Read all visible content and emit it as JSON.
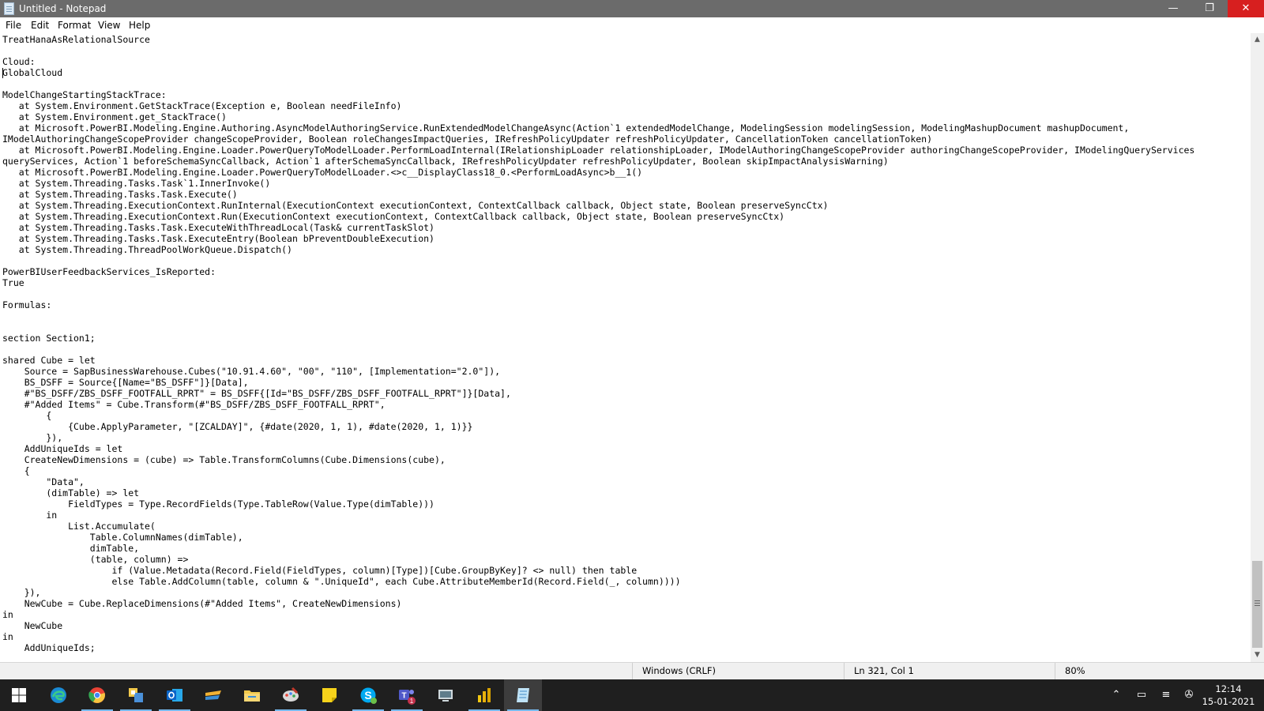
{
  "window": {
    "title": "Untitled - Notepad",
    "controls": {
      "minimize": "—",
      "maximize": "❐",
      "close": "✕"
    }
  },
  "menu": [
    "File",
    "Edit",
    "Format",
    "View",
    "Help"
  ],
  "editor": {
    "text": "TreatHanaAsRelationalSource\n\nCloud:\nGlobalCloud\n\nModelChangeStartingStackTrace:\n   at System.Environment.GetStackTrace(Exception e, Boolean needFileInfo)\n   at System.Environment.get_StackTrace()\n   at Microsoft.PowerBI.Modeling.Engine.Authoring.AsyncModelAuthoringService.RunExtendedModelChangeAsync(Action`1 extendedModelChange, ModelingSession modelingSession, ModelingMashupDocument mashupDocument,\nIModelAuthoringChangeScopeProvider changeScopeProvider, Boolean roleChangesImpactQueries, IRefreshPolicyUpdater refreshPolicyUpdater, CancellationToken cancellationToken)\n   at Microsoft.PowerBI.Modeling.Engine.Loader.PowerQueryToModelLoader.PerformLoadInternal(IRelationshipLoader relationshipLoader, IModelAuthoringChangeScopeProvider authoringChangeScopeProvider, IModelingQueryServices\nqueryServices, Action`1 beforeSchemaSyncCallback, Action`1 afterSchemaSyncCallback, IRefreshPolicyUpdater refreshPolicyUpdater, Boolean skipImpactAnalysisWarning)\n   at Microsoft.PowerBI.Modeling.Engine.Loader.PowerQueryToModelLoader.<>c__DisplayClass18_0.<PerformLoadAsync>b__1()\n   at System.Threading.Tasks.Task`1.InnerInvoke()\n   at System.Threading.Tasks.Task.Execute()\n   at System.Threading.ExecutionContext.RunInternal(ExecutionContext executionContext, ContextCallback callback, Object state, Boolean preserveSyncCtx)\n   at System.Threading.ExecutionContext.Run(ExecutionContext executionContext, ContextCallback callback, Object state, Boolean preserveSyncCtx)\n   at System.Threading.Tasks.Task.ExecuteWithThreadLocal(Task& currentTaskSlot)\n   at System.Threading.Tasks.Task.ExecuteEntry(Boolean bPreventDoubleExecution)\n   at System.Threading.ThreadPoolWorkQueue.Dispatch()\n\nPowerBIUserFeedbackServices_IsReported:\nTrue\n\nFormulas:\n\n\nsection Section1;\n\nshared Cube = let\n    Source = SapBusinessWarehouse.Cubes(\"10.91.4.60\", \"00\", \"110\", [Implementation=\"2.0\"]),\n    BS_DSFF = Source{[Name=\"BS_DSFF\"]}[Data],\n    #\"BS_DSFF/ZBS_DSFF_FOOTFALL_RPRT\" = BS_DSFF{[Id=\"BS_DSFF/ZBS_DSFF_FOOTFALL_RPRT\"]}[Data],\n    #\"Added Items\" = Cube.Transform(#\"BS_DSFF/ZBS_DSFF_FOOTFALL_RPRT\",\n        {\n            {Cube.ApplyParameter, \"[ZCALDAY]\", {#date(2020, 1, 1), #date(2020, 1, 1)}}\n        }),\n    AddUniqueIds = let\n    CreateNewDimensions = (cube) => Table.TransformColumns(Cube.Dimensions(cube),\n    {\n        \"Data\",\n        (dimTable) => let\n            FieldTypes = Type.RecordFields(Type.TableRow(Value.Type(dimTable)))\n        in\n            List.Accumulate(\n                Table.ColumnNames(dimTable),\n                dimTable,\n                (table, column) =>\n                    if (Value.Metadata(Record.Field(FieldTypes, column)[Type])[Cube.GroupByKey]? <> null) then table\n                    else Table.AddColumn(table, column & \".UniqueId\", each Cube.AttributeMemberId(Record.Field(_, column))))\n    }),\n    NewCube = Cube.ReplaceDimensions(#\"Added Items\", CreateNewDimensions)\nin\n    NewCube\nin\n    AddUniqueIds;"
  },
  "scrollbar": {
    "up_arrow": "▲",
    "down_arrow": "▼",
    "position_fraction": 0.87
  },
  "status": {
    "line_endings": "Windows (CRLF)",
    "cursor": "Ln 321, Col 1",
    "zoom": "80%"
  },
  "taskbar": {
    "apps": [
      {
        "name": "windows-start-icon"
      },
      {
        "name": "edge-icon"
      },
      {
        "name": "chrome-icon"
      },
      {
        "name": "app-icon"
      },
      {
        "name": "outlook-icon"
      },
      {
        "name": "sap-icon"
      },
      {
        "name": "file-explorer-icon"
      },
      {
        "name": "paint-icon"
      },
      {
        "name": "sticky-notes-icon"
      },
      {
        "name": "skype-icon"
      },
      {
        "name": "teams-icon",
        "badge": "1"
      },
      {
        "name": "network-app-icon"
      },
      {
        "name": "power-bi-icon"
      },
      {
        "name": "notepad-icon"
      }
    ],
    "tray": {
      "chevron": "⌃",
      "battery": "▭",
      "wifi": "≡",
      "volume": "✇"
    },
    "time": "12:14",
    "date": "15-01-2021"
  },
  "colors": {
    "titlebar": "#6b6b6b",
    "close": "#d71f1f",
    "taskbar": "#1f1f1f",
    "edge": "#1a8ad4",
    "chrome": "#e94235",
    "outlook": "#0a64c8",
    "explorer": "#f2c94c",
    "sticky": "#f7d31b",
    "skype": "#00a9f0",
    "teams": "#5059c9",
    "powerbi": "#f2c811"
  }
}
